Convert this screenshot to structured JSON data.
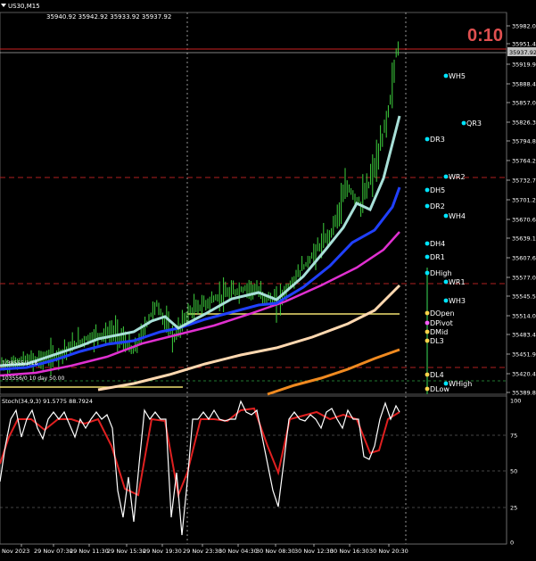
{
  "header": {
    "symbol_icon": "chart-dropdown-icon",
    "title": "US30,M15",
    "ohlc": "35940.92 35942.92 35933.92 35937.92",
    "timer": "0:10",
    "colors": {
      "timer": "#e05050"
    }
  },
  "price_axis": {
    "ticks": [
      "35982.00",
      "35951.40",
      "35919.95",
      "35888.40",
      "35857.00",
      "35826.30",
      "35794.80",
      "35764.20",
      "35732.70",
      "35701.20",
      "35670.60",
      "35639.10",
      "35607.60",
      "35577.00",
      "35545.50",
      "35514.00",
      "35483.40",
      "35451.90",
      "35420.40",
      "35389.80"
    ],
    "current_price": "35937.92",
    "colors": {
      "current_box": "#c0c0c0"
    }
  },
  "stoch": {
    "title": "Stoch(34,9,3) 91.5775 88.7924",
    "ticks": [
      "100",
      "75",
      "50",
      "25",
      "0"
    ]
  },
  "time_axis": {
    "ticks": [
      "Nov 2023",
      "29 Nov 07:30",
      "29 Nov 11:30",
      "29 Nov 15:30",
      "29 Nov 19:30",
      "29 Nov 23:30",
      "30 Nov 04:30",
      "30 Nov 08:30",
      "30 Nov 12:30",
      "30 Nov 16:30",
      "30 Nov 20:30"
    ]
  },
  "overlay_labels": {
    "left1": "1/38555/1/18",
    "left2": "103556/0 10 day 50.00"
  },
  "levels": [
    {
      "label": "WH5",
      "color": "#00e5ff"
    },
    {
      "label": "QR3",
      "color": "#00e5ff"
    },
    {
      "label": "DR3",
      "color": "#00e5ff"
    },
    {
      "label": "WR2",
      "color": "#00e5ff"
    },
    {
      "label": "DH5",
      "color": "#00e5ff"
    },
    {
      "label": "DR2",
      "color": "#00e5ff"
    },
    {
      "label": "WH4",
      "color": "#00e5ff"
    },
    {
      "label": "DH4",
      "color": "#00e5ff"
    },
    {
      "label": "DR1",
      "color": "#00e5ff"
    },
    {
      "label": "DHigh",
      "color": "#00e5ff"
    },
    {
      "label": "WR1",
      "color": "#00e5ff"
    },
    {
      "label": "WH3",
      "color": "#00e5ff"
    },
    {
      "label": "DOpen",
      "color": "#ffd54a"
    },
    {
      "label": "DPivot",
      "color": "#ff5cff"
    },
    {
      "label": "DMid",
      "color": "#ffd54a"
    },
    {
      "label": "DL3",
      "color": "#ffd54a"
    },
    {
      "label": "DL4",
      "color": "#ffd54a"
    },
    {
      "label": "WHigh",
      "color": "#00e5ff"
    },
    {
      "label": "DLow",
      "color": "#ffd54a"
    }
  ]
}
